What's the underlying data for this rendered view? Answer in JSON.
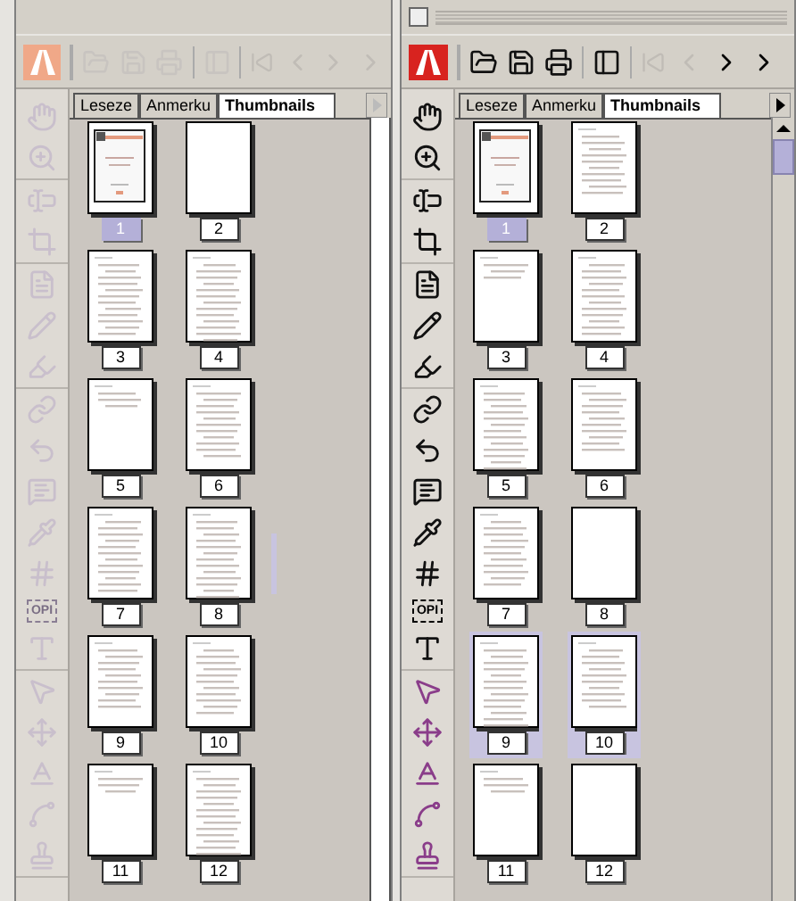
{
  "windows": [
    {
      "active": false,
      "tabs": [
        {
          "label": "Leseze",
          "selected": false
        },
        {
          "label": "Anmerku",
          "selected": false
        },
        {
          "label": "Thumbnails",
          "selected": true
        }
      ],
      "opi_label": "OPI",
      "pages": [
        {
          "label": "1",
          "selected": true,
          "highlighted": false,
          "kind": "cover"
        },
        {
          "label": "2",
          "selected": false,
          "highlighted": false,
          "kind": "blank"
        },
        {
          "label": "3",
          "selected": false,
          "highlighted": false,
          "kind": "text"
        },
        {
          "label": "4",
          "selected": false,
          "highlighted": false,
          "kind": "text"
        },
        {
          "label": "5",
          "selected": false,
          "highlighted": false,
          "kind": "sparse"
        },
        {
          "label": "6",
          "selected": false,
          "highlighted": false,
          "kind": "text"
        },
        {
          "label": "7",
          "selected": false,
          "highlighted": false,
          "kind": "text"
        },
        {
          "label": "8",
          "selected": false,
          "highlighted": false,
          "kind": "text"
        },
        {
          "label": "9",
          "selected": false,
          "highlighted": false,
          "kind": "text"
        },
        {
          "label": "10",
          "selected": false,
          "highlighted": false,
          "kind": "text"
        },
        {
          "label": "11",
          "selected": false,
          "highlighted": false,
          "kind": "sparse"
        },
        {
          "label": "12",
          "selected": false,
          "highlighted": false,
          "kind": "text"
        }
      ]
    },
    {
      "active": true,
      "tabs": [
        {
          "label": "Leseze",
          "selected": false
        },
        {
          "label": "Anmerku",
          "selected": false
        },
        {
          "label": "Thumbnails",
          "selected": true
        }
      ],
      "opi_label": "OPI",
      "pages": [
        {
          "label": "1",
          "selected": true,
          "highlighted": false,
          "kind": "cover"
        },
        {
          "label": "2",
          "selected": false,
          "highlighted": false,
          "kind": "text"
        },
        {
          "label": "3",
          "selected": false,
          "highlighted": false,
          "kind": "sparse"
        },
        {
          "label": "4",
          "selected": false,
          "highlighted": false,
          "kind": "text"
        },
        {
          "label": "5",
          "selected": false,
          "highlighted": false,
          "kind": "text"
        },
        {
          "label": "6",
          "selected": false,
          "highlighted": false,
          "kind": "text"
        },
        {
          "label": "7",
          "selected": false,
          "highlighted": false,
          "kind": "text"
        },
        {
          "label": "8",
          "selected": false,
          "highlighted": false,
          "kind": "blank"
        },
        {
          "label": "9",
          "selected": false,
          "highlighted": true,
          "kind": "text"
        },
        {
          "label": "10",
          "selected": false,
          "highlighted": true,
          "kind": "text"
        },
        {
          "label": "11",
          "selected": false,
          "highlighted": false,
          "kind": "sparse"
        },
        {
          "label": "12",
          "selected": false,
          "highlighted": false,
          "kind": "blank"
        }
      ]
    }
  ]
}
